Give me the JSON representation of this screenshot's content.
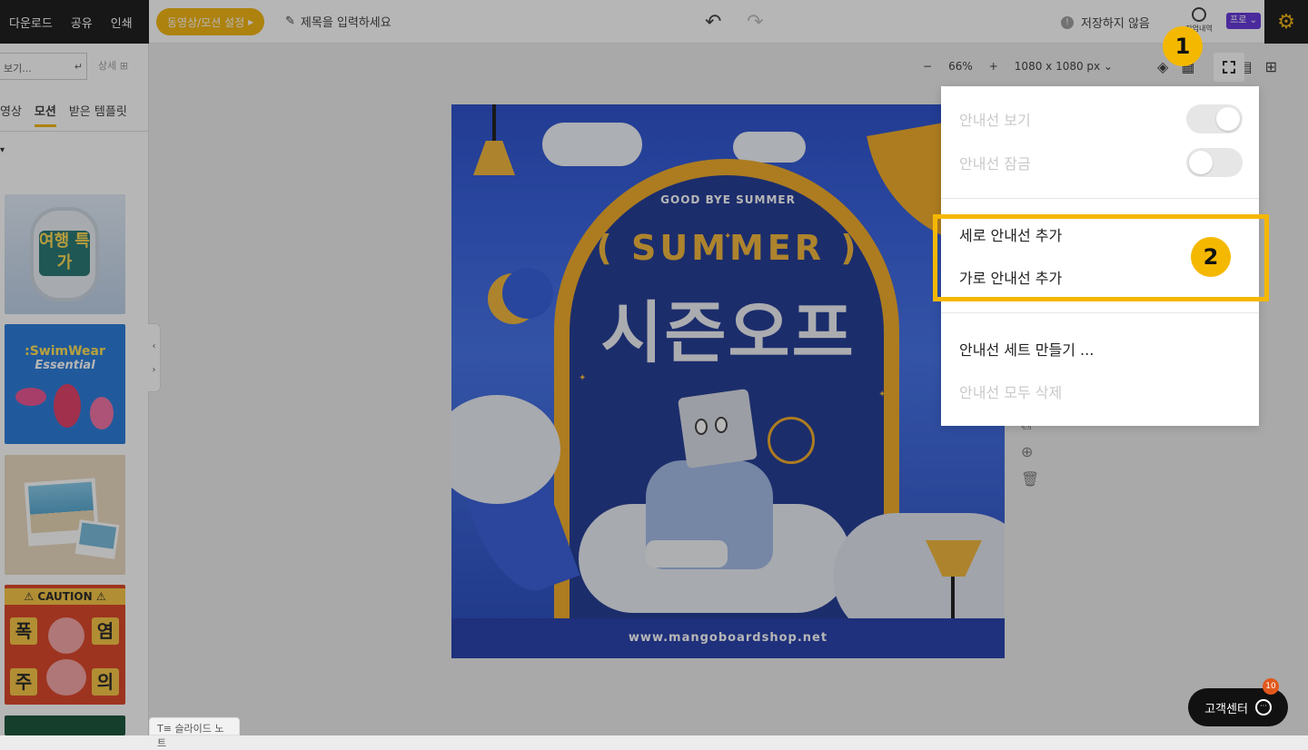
{
  "topbar": {
    "download": "다운로드",
    "share": "공유",
    "print": "인쇄",
    "video_setting": "동영상/모션 설정",
    "title_placeholder": "제목을 입력하세요",
    "save_status": "저장하지 않음",
    "history_label": "작업내역",
    "pro_label": "프로"
  },
  "leftpanel": {
    "search_placeholder": "보기...",
    "detail": "상세",
    "tabs": [
      "영상",
      "모션",
      "받은 템플릿"
    ],
    "active_tab": "모션",
    "templates": [
      {
        "text": "여행 특가"
      },
      {
        "text": ":SwimWear",
        "sub": "Essential"
      },
      {
        "text": "photo"
      },
      {
        "banner": "CAUTION",
        "chars": [
          "폭",
          "염",
          "주",
          "의"
        ]
      }
    ]
  },
  "canvas": {
    "zoom": "66%",
    "size": "1080 x 1080 px",
    "poster": {
      "subtitle": "GOOD BYE SUMMER",
      "summer": "( SUMMER )",
      "title": "시즌오프",
      "url": "www.mangoboardshop.net"
    }
  },
  "menu": {
    "show_guides": "안내선 보기",
    "lock_guides": "안내선 잠금",
    "add_vertical": "세로 안내선 추가",
    "add_horizontal": "가로 안내선 추가",
    "make_set": "안내선 세트 만들기 ...",
    "delete_all": "안내선 모두 삭제"
  },
  "annotations": {
    "step1": "1",
    "step2": "2"
  },
  "bottom": {
    "slide_note": "슬라이드 노트",
    "help_center": "고객센터",
    "help_count": "10"
  },
  "colors": {
    "accent": "#f5b800",
    "topbar_dark": "#0f0f0f",
    "pro": "#5b2bd8"
  }
}
